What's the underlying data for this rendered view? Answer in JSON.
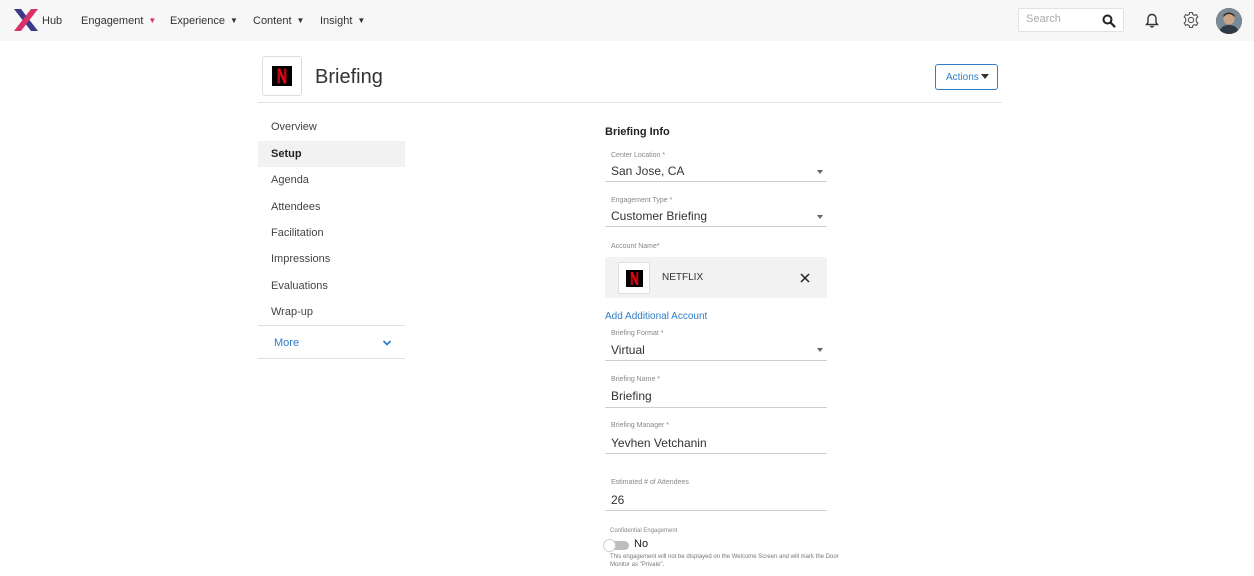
{
  "topnav": {
    "app_name": "Hub",
    "menus": [
      {
        "label": "Engagement"
      },
      {
        "label": "Experience"
      },
      {
        "label": "Content"
      },
      {
        "label": "Insight"
      }
    ],
    "search_placeholder": "Search",
    "icons": [
      "search-icon",
      "bell-icon",
      "gear-icon",
      "avatar"
    ],
    "accent_color": "#d93068"
  },
  "header": {
    "title": "Briefing",
    "actions_label": "Actions"
  },
  "sidenav": {
    "items": [
      {
        "label": "Overview"
      },
      {
        "label": "Setup",
        "active": true
      },
      {
        "label": "Agenda"
      },
      {
        "label": "Attendees"
      },
      {
        "label": "Facilitation"
      },
      {
        "label": "Impressions"
      },
      {
        "label": "Evaluations"
      },
      {
        "label": "Wrap-up"
      }
    ],
    "more_label": "More"
  },
  "form": {
    "section_title": "Briefing Info",
    "center_location": {
      "label": "Center Location *",
      "value": "San Jose, CA"
    },
    "engagement_type": {
      "label": "Engagement Type *",
      "value": "Customer Briefing"
    },
    "account_name": {
      "label": "Account Name*",
      "value": "NETFLIX"
    },
    "add_account_label": "Add Additional Account",
    "briefing_format": {
      "label": "Briefing Format *",
      "value": "Virtual"
    },
    "briefing_name": {
      "label": "Briefing Name *",
      "value": "Briefing"
    },
    "briefing_manager": {
      "label": "Briefing Manager *",
      "value": "Yevhen Vetchanin"
    },
    "estimated_attendees": {
      "label": "Estimated # of Attendees",
      "value": "26"
    },
    "confidential": {
      "label": "Confidential Engagement",
      "value": "No",
      "note": "This engagement will not be displayed on the Welcome Screen and will mark the Door Monitor as \"Private\"."
    }
  },
  "colors": {
    "link_blue": "#2f7ec7",
    "brand_red": "#e50914"
  }
}
